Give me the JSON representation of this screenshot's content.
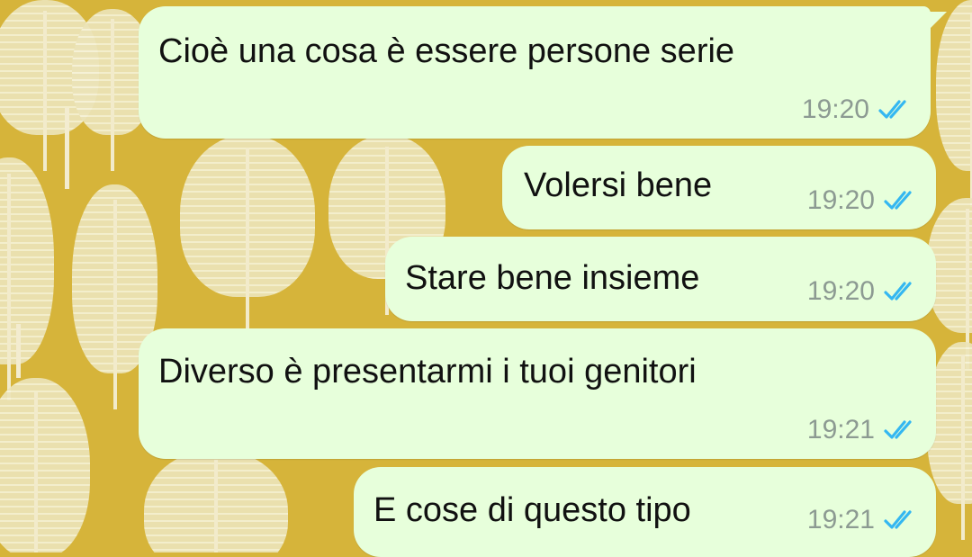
{
  "theme": {
    "wallpaper_color": "#d6b43a",
    "bubble_color": "#e7ffdb",
    "tick_color": "#34b7f1"
  },
  "messages": [
    {
      "text": "Cioè una cosa è essere persone serie",
      "time": "19:20",
      "status_icon": "double-check-read-icon"
    },
    {
      "text": "Volersi bene",
      "time": "19:20",
      "status_icon": "double-check-read-icon"
    },
    {
      "text": "Stare bene insieme",
      "time": "19:20",
      "status_icon": "double-check-read-icon"
    },
    {
      "text": "Diverso è presentarmi i tuoi genitori",
      "time": "19:21",
      "status_icon": "double-check-read-icon"
    },
    {
      "text": "E cose di questo tipo",
      "time": "19:21",
      "status_icon": "double-check-read-icon"
    }
  ]
}
